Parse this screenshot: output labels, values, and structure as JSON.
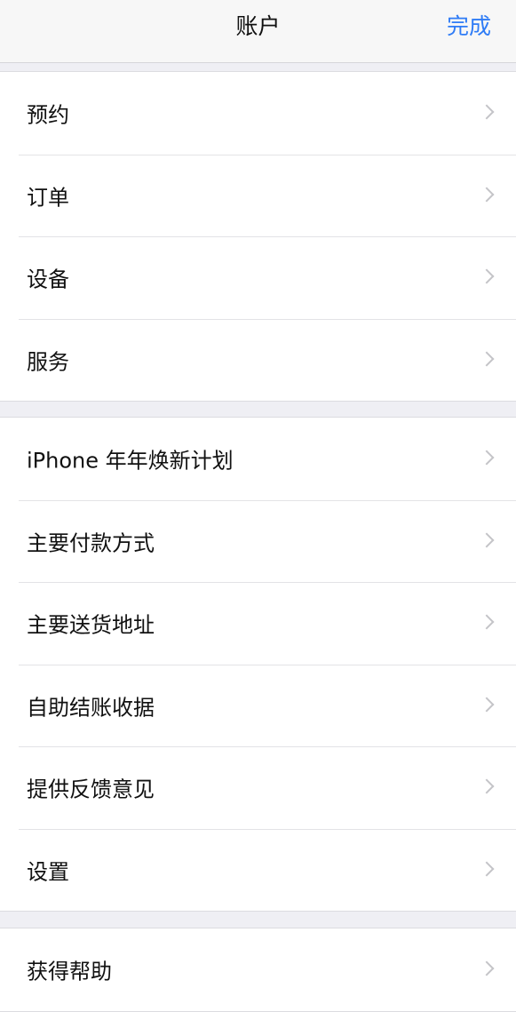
{
  "navbar": {
    "title": "账户",
    "done_label": "完成"
  },
  "sections": [
    {
      "items": [
        {
          "label": "预约"
        },
        {
          "label": "订单"
        },
        {
          "label": "设备"
        },
        {
          "label": "服务"
        }
      ]
    },
    {
      "items": [
        {
          "label": "iPhone 年年焕新计划"
        },
        {
          "label": "主要付款方式"
        },
        {
          "label": "主要送货地址"
        },
        {
          "label": "自助结账收据"
        },
        {
          "label": "提供反馈意见"
        },
        {
          "label": "设置"
        }
      ]
    },
    {
      "items": [
        {
          "label": "获得帮助"
        }
      ]
    }
  ],
  "colors": {
    "accent": "#2f7cf6",
    "background": "#efeff4",
    "chevron": "#c4c4c8"
  },
  "icons": {
    "disclosure": "chevron-right-icon"
  }
}
